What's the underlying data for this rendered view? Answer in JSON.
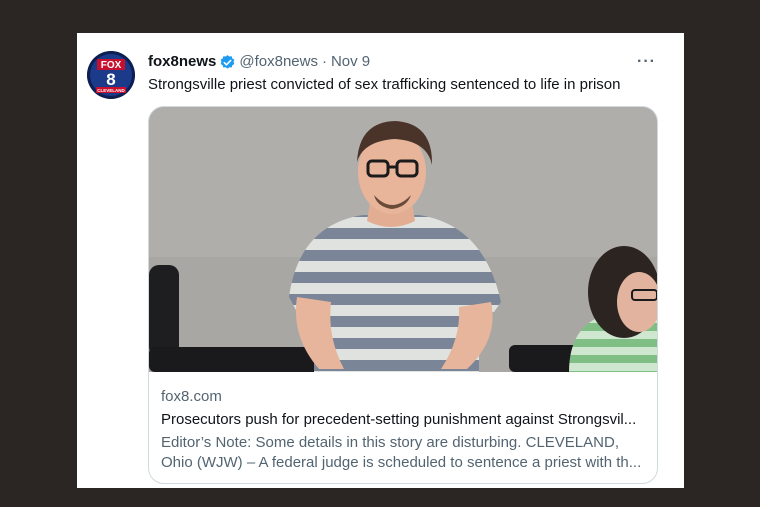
{
  "tweet": {
    "avatar": {
      "brand_text": "FOX",
      "number": "8",
      "city": "CLEVELAND"
    },
    "display_name": "fox8news",
    "verified_icon": "verified-badge-icon",
    "handle": "@fox8news",
    "separator": "·",
    "date": "Nov 9",
    "more_label": "···",
    "text": "Strongsville priest convicted of sex trafficking sentenced to life in prison"
  },
  "link_card": {
    "domain": "fox8.com",
    "title": "Prosecutors push for precedent-setting punishment against Strongsvil...",
    "description_line1": "Editor’s Note: Some details in this story are disturbing. CLEVELAND,",
    "description_line2": "Ohio (WJW) – A federal judge is scheduled to sentence a priest with th..."
  },
  "colors": {
    "background": "#2b2623",
    "card": "#ffffff",
    "verified": "#1d9bf0",
    "secondary_text": "#536471"
  }
}
